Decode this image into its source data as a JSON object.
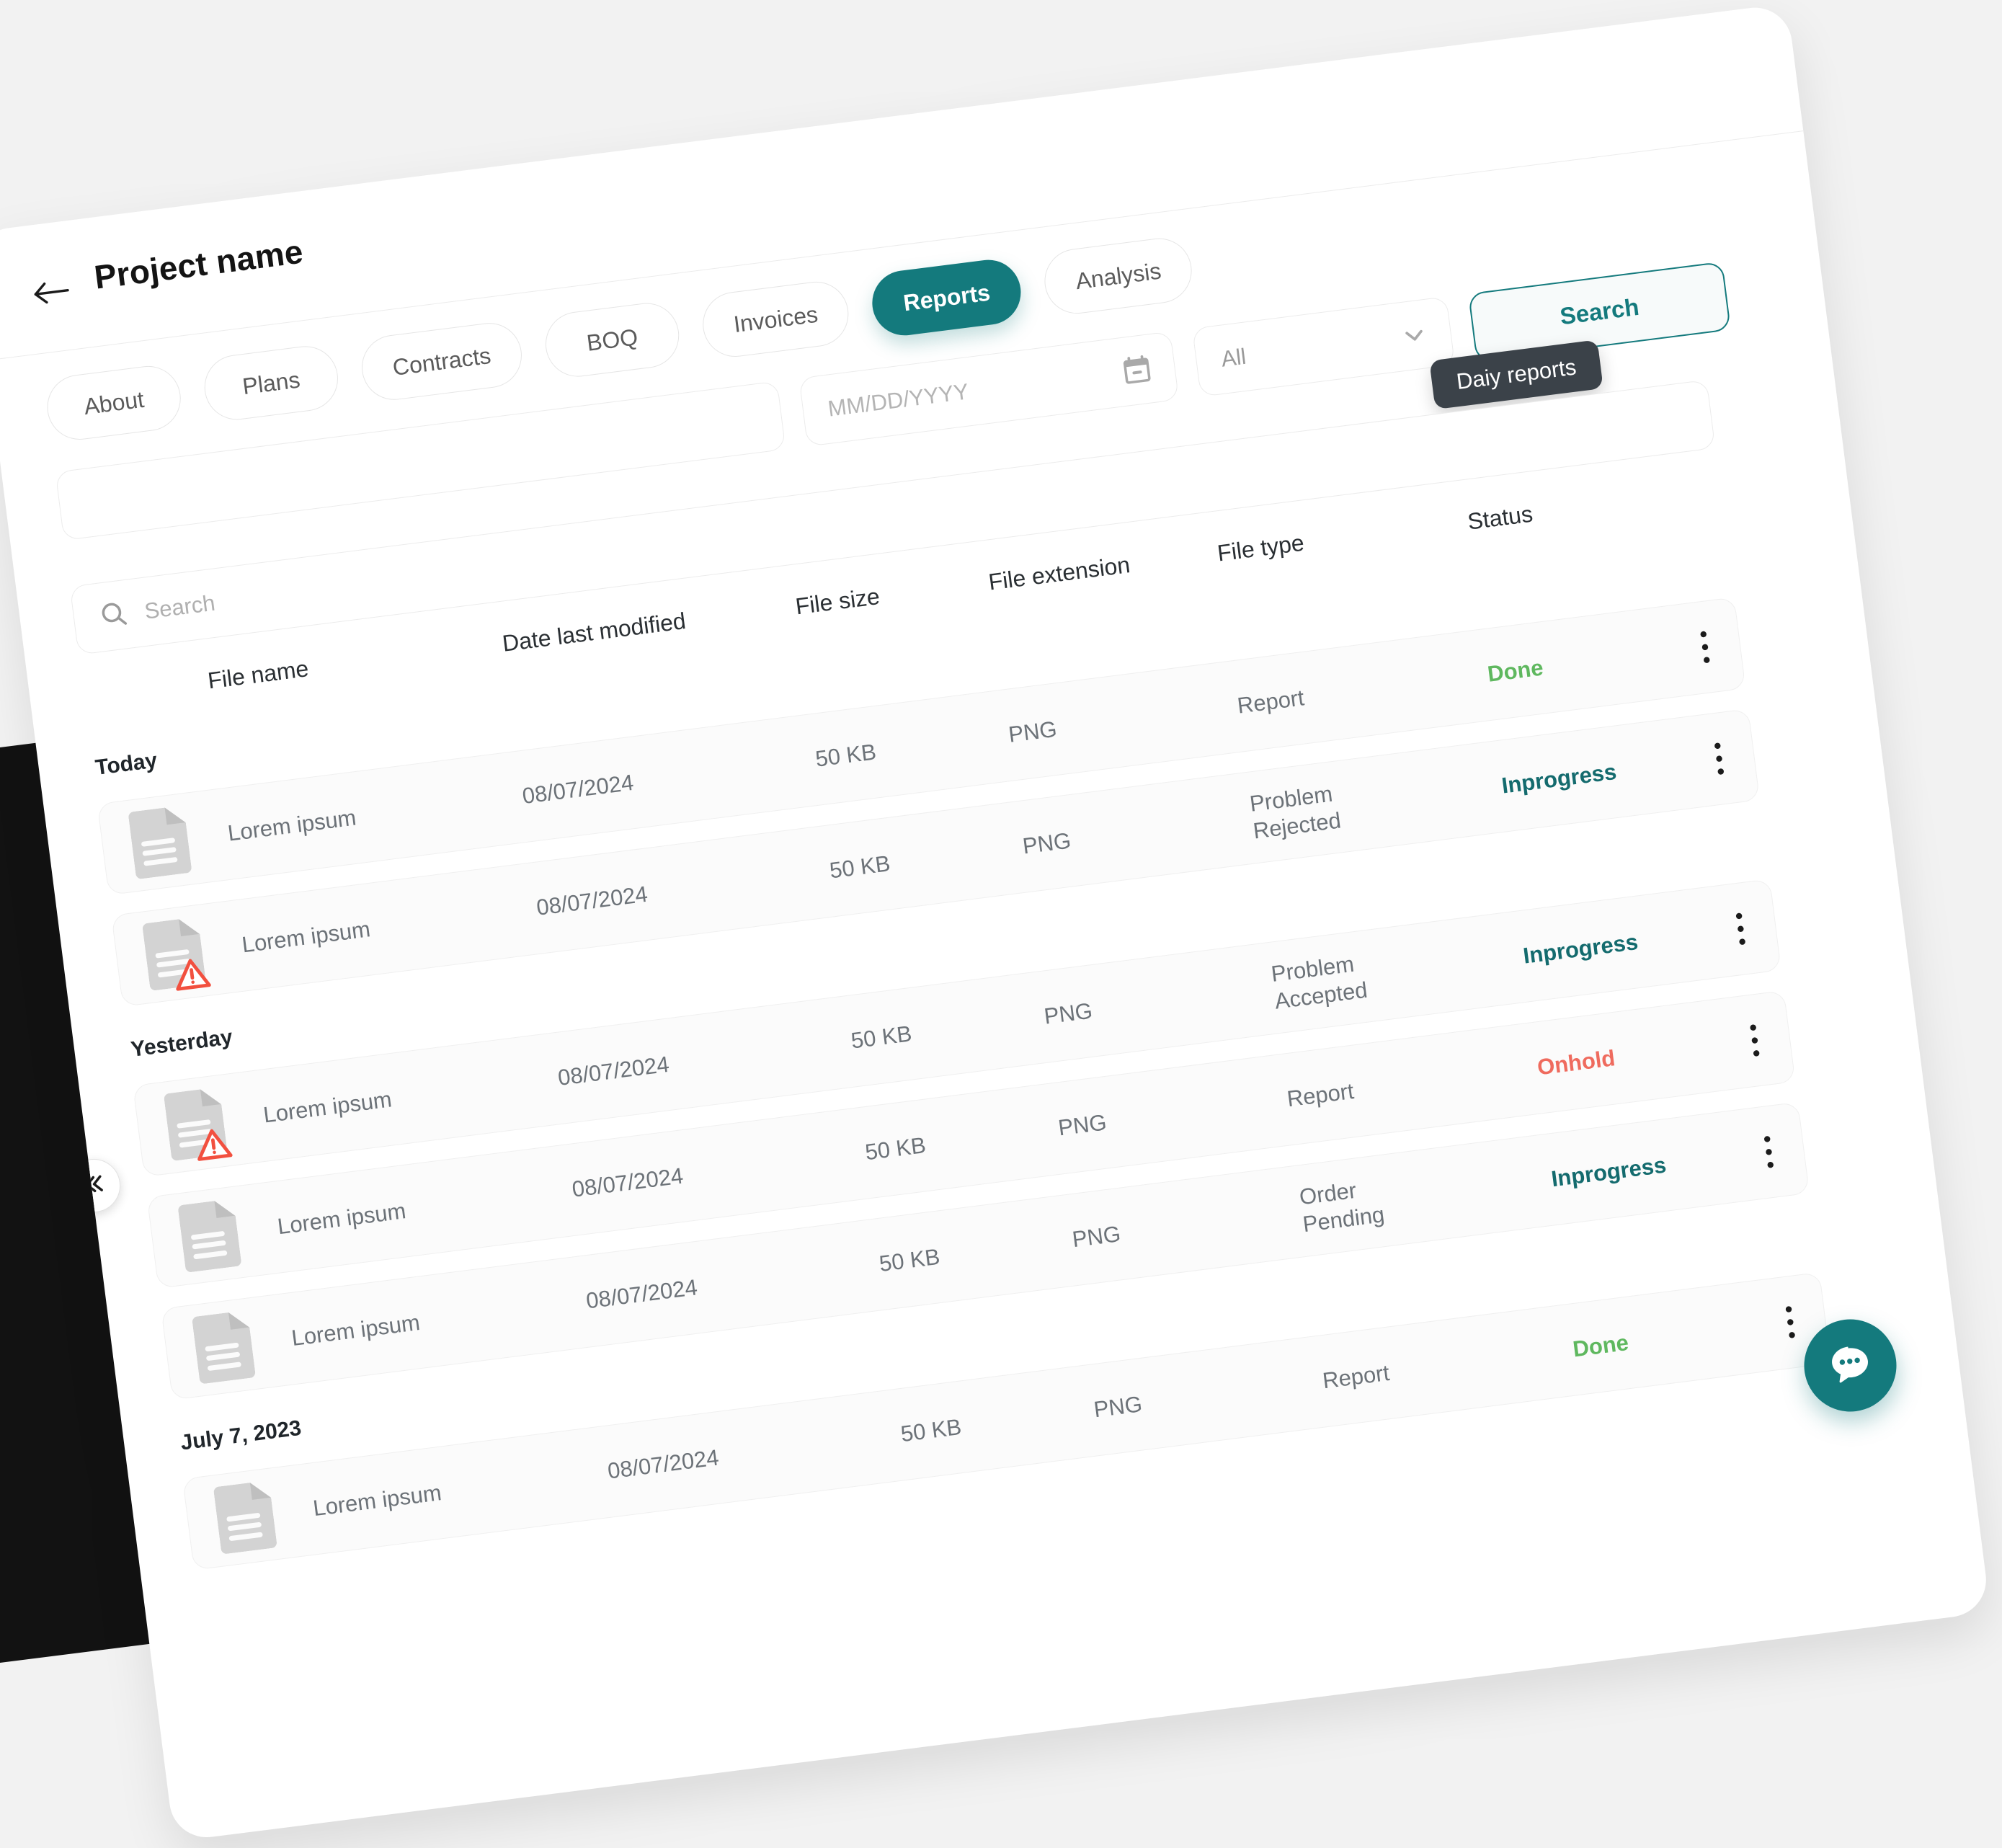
{
  "header": {
    "back_icon": "arrow-left-icon",
    "project_title": "Project name"
  },
  "nav": {
    "items": [
      {
        "label": "About",
        "active": false
      },
      {
        "label": "Plans",
        "active": false
      },
      {
        "label": "Contracts",
        "active": false
      },
      {
        "label": "BOQ",
        "active": false
      },
      {
        "label": "Invoices",
        "active": false
      },
      {
        "label": "Reports",
        "active": true
      },
      {
        "label": "Analysis",
        "active": false
      }
    ]
  },
  "filters": {
    "text_field": {
      "value": "",
      "placeholder": ""
    },
    "date_field": {
      "value": "",
      "placeholder": "MM/DD/YYYY",
      "icon": "calendar-icon"
    },
    "status_select": {
      "value": "All",
      "icon": "chevron-down-icon"
    },
    "search_button": {
      "label": "Search"
    }
  },
  "tooltip": {
    "text": "Daiy reports"
  },
  "table_search": {
    "placeholder": "Search",
    "value": "",
    "icon": "search-icon"
  },
  "table": {
    "columns": [
      "File name",
      "Date last modified",
      "File size",
      "File extension",
      "File type",
      "Status"
    ],
    "groups": [
      {
        "label": "Today",
        "rows": [
          {
            "name": "Lorem ipsum",
            "date": "08/07/2024",
            "size": "50 KB",
            "ext": "PNG",
            "type": "Report",
            "status": "Done",
            "status_color": "#5FB85F",
            "warning": false
          },
          {
            "name": "Lorem ipsum",
            "date": "08/07/2024",
            "size": "50 KB",
            "ext": "PNG",
            "type": "Problem Rejected",
            "status": "Inprogress",
            "status_color": "#146B6E",
            "warning": true
          }
        ]
      },
      {
        "label": "Yesterday",
        "rows": [
          {
            "name": "Lorem ipsum",
            "date": "08/07/2024",
            "size": "50 KB",
            "ext": "PNG",
            "type": "Problem Accepted",
            "status": "Inprogress",
            "status_color": "#146B6E",
            "warning": true
          },
          {
            "name": "Lorem ipsum",
            "date": "08/07/2024",
            "size": "50 KB",
            "ext": "PNG",
            "type": "Report",
            "status": "Onhold",
            "status_color": "#EF6B5E",
            "warning": false
          },
          {
            "name": "Lorem ipsum",
            "date": "08/07/2024",
            "size": "50 KB",
            "ext": "PNG",
            "type": "Order Pending",
            "status": "Inprogress",
            "status_color": "#146B6E",
            "warning": false
          }
        ]
      },
      {
        "label": "July 7, 2023",
        "rows": [
          {
            "name": "Lorem ipsum",
            "date": "08/07/2024",
            "size": "50 KB",
            "ext": "PNG",
            "type": "Report",
            "status": "Done",
            "status_color": "#5FB85F",
            "warning": false
          }
        ]
      }
    ]
  },
  "collapse_button": {
    "icon": "chevrons-left-icon"
  },
  "chat_fab": {
    "icon": "chat-bubble-icon"
  },
  "theme": {
    "accent": "#147A7D",
    "tooltip_bg": "#3B4249",
    "page_bg": "#F2F2F2",
    "card_bg": "#FFFFFF"
  }
}
